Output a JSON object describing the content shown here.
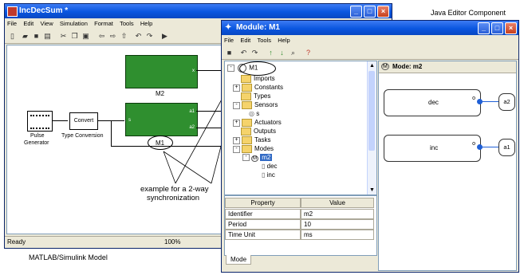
{
  "simulink": {
    "title": "IncDecSum *",
    "menu": [
      "File",
      "Edit",
      "View",
      "Simulation",
      "Format",
      "Tools",
      "Help"
    ],
    "blocks": {
      "m2_label": "M2",
      "m1_label": "M1",
      "port_x": "x",
      "port_s": "s",
      "port_a1": "a1",
      "port_a2": "a2",
      "convert": "Convert",
      "type_conversion": "Type Conversion",
      "pulse_line1": "Pulse",
      "pulse_line2": "Generator"
    },
    "status_ready": "Ready",
    "status_zoom": "100%",
    "caption": "MATLAB/Simulink Model"
  },
  "annotation": {
    "line1": "example for a 2-way",
    "line2": "synchronization"
  },
  "java": {
    "caption": "Java Editor Component",
    "title": "Module: M1",
    "menu": [
      "File",
      "Edit",
      "Tools",
      "Help"
    ],
    "tree": {
      "root": "M1",
      "imports": "Imports",
      "constants": "Constants",
      "types": "Types",
      "sensors": "Sensors",
      "sensor_s": "s",
      "actuators": "Actuators",
      "outputs": "Outputs",
      "tasks": "Tasks",
      "modes": "Modes",
      "mode_m2": "m2",
      "dec": "dec",
      "inc": "inc"
    },
    "mode_panel_title": "Mode: m2",
    "mode_boxes": {
      "dec": "dec",
      "inc": "inc",
      "port_o": "o",
      "a2": "a2",
      "a1": "a1"
    },
    "property_header": "Property",
    "value_header": "Value",
    "properties": [
      {
        "name": "Identifier",
        "value": "m2"
      },
      {
        "name": "Period",
        "value": "10"
      },
      {
        "name": "Time Unit",
        "value": "ms"
      }
    ],
    "tab": "Mode"
  }
}
